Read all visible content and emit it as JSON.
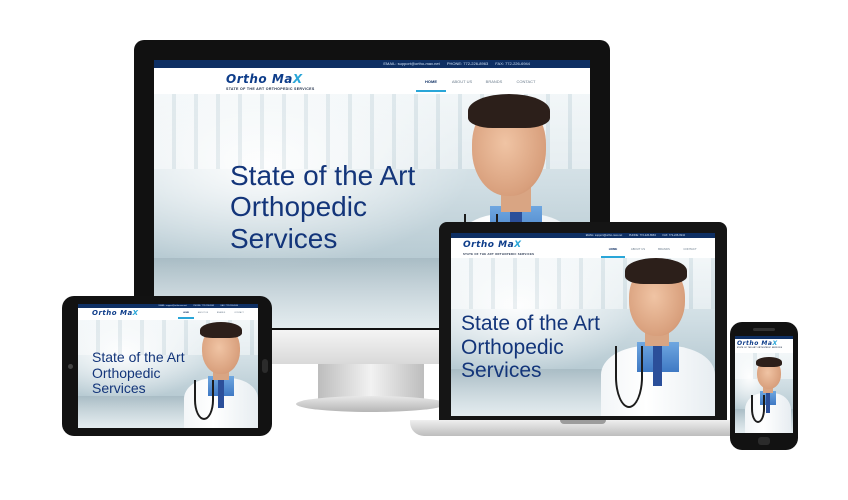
{
  "site": {
    "logo_main": "Ortho Ma",
    "logo_x": "X",
    "tagline": "STATE OF THE ART ORTHOPEDIC SERVICES",
    "contact": {
      "email": "EMAIL: support@ortho-max.net",
      "phone": "PHONE: 772-226-8963",
      "fax": "FAX: 772-226-6944"
    },
    "nav": [
      "HOME",
      "ABOUT US",
      "BRANDS",
      "CONTACT"
    ],
    "headline": [
      "State of the Art",
      "Orthopedic",
      "Services"
    ]
  },
  "colors": {
    "brand_navy": "#0e2f63",
    "brand_blue": "#13357a",
    "accent_cyan": "#2aa6d8",
    "device_black": "#111111"
  }
}
